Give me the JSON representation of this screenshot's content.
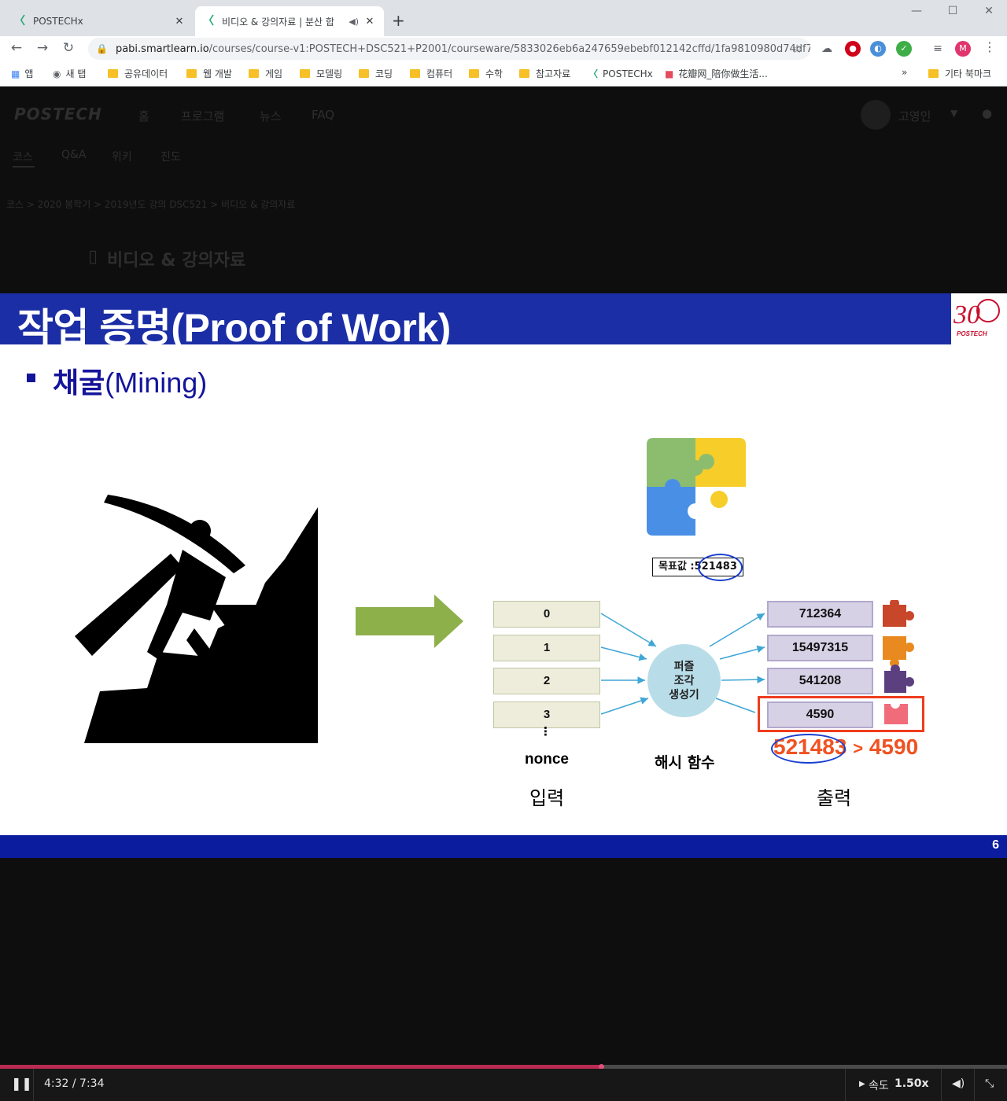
{
  "browser": {
    "tabs": [
      {
        "title": "POSTECHx",
        "active": false
      },
      {
        "title": "비디오 & 강의자료 | 분산 합",
        "active": true
      }
    ],
    "url_host": "pabi.smartlearn.io",
    "url_path": "/courses/course-v1:POSTECH+DSC521+P2001/courseware/5833026eb6a247659ebebf012142cffd/1fa9810980d74df7...",
    "profile_initial": "M",
    "bookmarks": [
      "앱",
      "새 탭",
      "공유데이터",
      "웹 개발",
      "게임",
      "모델링",
      "코딩",
      "컴퓨터",
      "수학",
      "참고자료",
      "POSTECHx",
      "花瓣网_陪你做生活...",
      "»",
      "기타 북마크"
    ]
  },
  "site": {
    "logo": "POSTECH",
    "nav": [
      "홈",
      "프로그램",
      "뉴스",
      "FAQ"
    ],
    "user": "고영인",
    "subnav": [
      "코스",
      "Q&A",
      "위키",
      "진도"
    ],
    "breadcrumb": "코스 > 2020 봄학기 > 2019년도 강의 DSC521 > 비디오 & 강의자료",
    "section_title": "비디오 & 강의자료"
  },
  "slide": {
    "title": "작업 증명(Proof of Work)",
    "logo_number": "30",
    "logo_caption": "POSTECH",
    "bullet_bold": "채굴",
    "bullet_rest": "(Mining)",
    "target_label": "목표값 :",
    "target_value": "521483",
    "inputs": [
      "0",
      "1",
      "2",
      "3"
    ],
    "input_ellipsis": "⋮",
    "nonce_label": "nonce",
    "input_label": "입력",
    "hash_node": [
      "퍼즐",
      "조각",
      "생성기"
    ],
    "hash_label": "해시 함수",
    "outputs": [
      "712364",
      "15497315",
      "541208",
      "4590"
    ],
    "output_label": "출력",
    "compare_left": "521483",
    "compare_op": ">",
    "compare_right": "4590",
    "page_number": "6",
    "colors": {
      "title_bar": "#1b2ea5",
      "footer_bar": "#0b1c9e",
      "arrow": "#8db04a",
      "highlight": "#ee3d1f"
    }
  },
  "player": {
    "time": "4:32 / 7:34",
    "progress": 0.597,
    "speed_label": "속도",
    "speed_value": "1.50x"
  }
}
